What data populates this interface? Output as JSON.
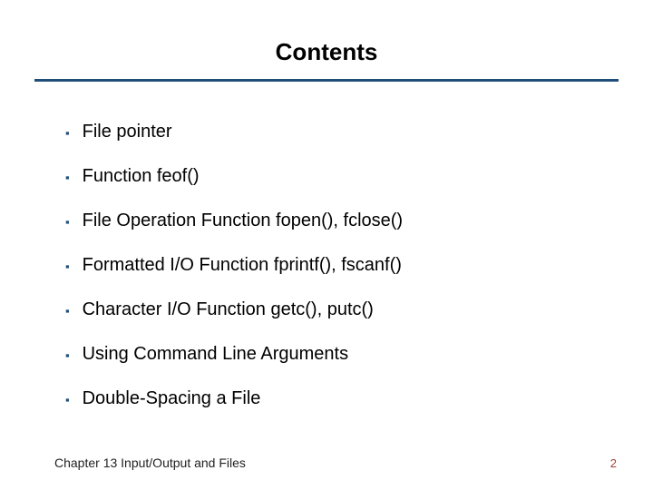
{
  "title": "Contents",
  "items": [
    "File pointer",
    "Function feof()",
    "File Operation Function fopen(), fclose()",
    "Formatted I/O Function fprintf(), fscanf()",
    "Character I/O Function getc(), putc()",
    "Using Command Line Arguments",
    "Double-Spacing a File"
  ],
  "footer": {
    "chapter": "Chapter 13  Input/Output and Files",
    "page": "2"
  }
}
